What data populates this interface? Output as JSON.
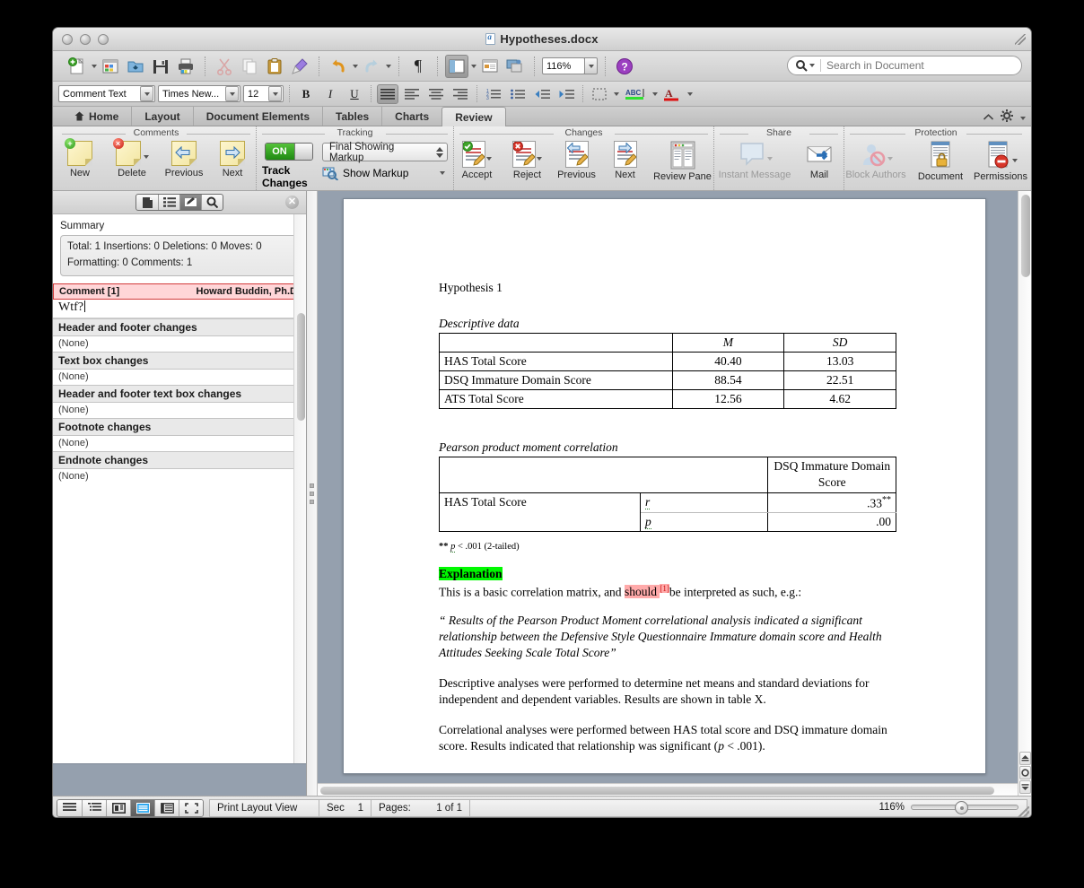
{
  "window": {
    "title": "Hypotheses.docx",
    "traffic_lights": [
      "close",
      "minimize",
      "zoom"
    ]
  },
  "standard_toolbar": {
    "items": [
      {
        "name": "new-document",
        "label": "New"
      },
      {
        "name": "open-template-gallery",
        "label": "Template Gallery"
      },
      {
        "name": "open",
        "label": "Open"
      },
      {
        "name": "save",
        "label": "Save"
      },
      {
        "name": "print",
        "label": "Print"
      },
      {
        "name": "cut",
        "label": "Cut"
      },
      {
        "name": "copy",
        "label": "Copy"
      },
      {
        "name": "paste",
        "label": "Paste"
      },
      {
        "name": "format-painter",
        "label": "Format"
      },
      {
        "name": "undo",
        "label": "Undo"
      },
      {
        "name": "redo",
        "label": "Redo"
      },
      {
        "name": "show-paragraph-marks",
        "label": "¶"
      },
      {
        "name": "sidebar-toggle",
        "label": "Sidebar"
      },
      {
        "name": "media-browser",
        "label": "Media Browser"
      },
      {
        "name": "gallery",
        "label": "Gallery"
      },
      {
        "name": "help",
        "label": "Help"
      }
    ],
    "zoom_value": "116%"
  },
  "search": {
    "placeholder": "Search in Document",
    "value": ""
  },
  "formatting_toolbar": {
    "style": "Comment Text",
    "font": "Times New...",
    "size": "12",
    "bold": "B",
    "italic": "I",
    "underline": "U",
    "align": [
      "align-justify",
      "align-left",
      "align-center",
      "align-right"
    ],
    "lists": [
      "numbered-list",
      "bulleted-list"
    ],
    "indent": [
      "decrease-indent",
      "increase-indent"
    ],
    "borders": "borders",
    "highlight": "ABC",
    "font-color": "A"
  },
  "tabs": [
    {
      "label": "Home",
      "active": false,
      "icon": "home-icon"
    },
    {
      "label": "Layout",
      "active": false
    },
    {
      "label": "Document Elements",
      "active": false
    },
    {
      "label": "Tables",
      "active": false
    },
    {
      "label": "Charts",
      "active": false
    },
    {
      "label": "Review",
      "active": true
    }
  ],
  "ribbon": {
    "groups": [
      {
        "title": "Comments",
        "items": [
          {
            "label": "New",
            "icon": "new-comment-icon",
            "dim": false,
            "caret": false
          },
          {
            "label": "Delete",
            "icon": "delete-comment-icon",
            "dim": false,
            "caret": true
          },
          {
            "label": "Previous",
            "icon": "previous-comment-icon",
            "dim": false,
            "caret": false
          },
          {
            "label": "Next",
            "icon": "next-comment-icon",
            "dim": false,
            "caret": false
          }
        ]
      },
      {
        "title": "Tracking",
        "toggle_state": "ON",
        "toggle_label": "Track Changes",
        "markup_mode": "Final Showing Markup",
        "show_markup_label": "Show Markup"
      },
      {
        "title": "Changes",
        "items": [
          {
            "label": "Accept",
            "icon": "accept-change-icon",
            "dim": false,
            "caret": true
          },
          {
            "label": "Reject",
            "icon": "reject-change-icon",
            "dim": false,
            "caret": true
          },
          {
            "label": "Previous",
            "icon": "previous-change-icon",
            "dim": false,
            "caret": false
          },
          {
            "label": "Next",
            "icon": "next-change-icon",
            "dim": false,
            "caret": false
          },
          {
            "label": "Review Pane",
            "icon": "review-pane-icon",
            "dim": false,
            "caret": false
          }
        ]
      },
      {
        "title": "Share",
        "items": [
          {
            "label": "Instant Message",
            "icon": "instant-message-icon",
            "dim": true,
            "caret": true
          },
          {
            "label": "Mail",
            "icon": "mail-icon",
            "dim": false,
            "caret": false
          }
        ]
      },
      {
        "title": "Protection",
        "items": [
          {
            "label": "Block Authors",
            "icon": "block-authors-icon",
            "dim": true,
            "caret": true
          },
          {
            "label": "Document",
            "icon": "protect-document-icon",
            "dim": false,
            "caret": false
          },
          {
            "label": "Permissions",
            "icon": "permissions-icon",
            "dim": false,
            "caret": true
          }
        ]
      }
    ]
  },
  "review_pane": {
    "seg_buttons": [
      "document-map-icon",
      "thumbnails-icon",
      "reviewing-icon",
      "search-icon"
    ],
    "active_seg": 2,
    "close_label": "✕",
    "summary_label": "Summary",
    "summary_line1": "Total: 1   Insertions: 0   Deletions: 0   Moves: 0",
    "summary_line2": "Formatting: 0   Comments: 1",
    "comment": {
      "label": "Comment [1]",
      "author": "Howard Buddin, Ph.D.",
      "text": "Wtf?"
    },
    "sections": [
      {
        "heading": "Header and footer changes",
        "value": "(None)"
      },
      {
        "heading": "Text box changes",
        "value": "(None)"
      },
      {
        "heading": "Header and footer text box changes",
        "value": "(None)"
      },
      {
        "heading": "Footnote changes",
        "value": "(None)"
      },
      {
        "heading": "Endnote changes",
        "value": "(None)"
      }
    ]
  },
  "document": {
    "heading": "Hypothesis 1",
    "descriptive_caption": "Descriptive data",
    "descriptive_table": {
      "headers": [
        "",
        "M",
        "SD"
      ],
      "rows": [
        [
          "HAS Total Score",
          "40.40",
          "13.03"
        ],
        [
          "DSQ Immature Domain Score",
          "88.54",
          "22.51"
        ],
        [
          "ATS Total Score",
          "12.56",
          "4.62"
        ]
      ]
    },
    "correlation_caption": "Pearson product moment correlation",
    "correlation_table": {
      "col_header": "DSQ Immature Domain Score",
      "row_label": "HAS Total Score",
      "stat_r": "r",
      "stat_p": "p",
      "value_r": ".33",
      "value_r_sup": "**",
      "value_p": ".00"
    },
    "footnote": "** p < .001 (2-tailed)",
    "footnote_prefix": "**",
    "footnote_stat": "p",
    "footnote_rest": "< .001 (2-tailed)",
    "explanation_heading": "Explanation",
    "explanation_line_a": "This is a basic correlation matrix, and ",
    "explanation_highlight": "should ",
    "explanation_comment_ref": "[1]",
    "explanation_line_b": "be interpreted as such, e.g.:",
    "quote": "“ Results of the Pearson Product Moment correlational analysis indicated a significant relationship between the Defensive Style Questionnaire Immature domain score and Health Attitudes Seeking Scale Total Score”",
    "para1": "Descriptive analyses were performed to determine net means and standard deviations for independent and dependent variables. Results are shown in table X.",
    "para2_a": "Correlational analyses were performed between HAS total score and DSQ immature domain score. Results indicated that relationship was significant (",
    "para2_stat": "p",
    "para2_b": " < .001)."
  },
  "status_bar": {
    "view_buttons": [
      "draft-view-icon",
      "outline-view-icon",
      "publishing-view-icon",
      "print-layout-view-icon",
      "notebook-view-icon",
      "full-screen-view-icon"
    ],
    "active_view": 3,
    "view_label": "Print Layout View",
    "sec_label": "Sec",
    "sec_value": "1",
    "pages_label": "Pages:",
    "pages_value": "1 of 1",
    "zoom_value": "116%"
  },
  "colors": {
    "accent_green": "#00f900",
    "comment_pink": "#ffaaaa",
    "comment_border": "#d23b3b",
    "canvas_bg": "#95a0ae",
    "toggle_on": "#2f9b1c"
  }
}
